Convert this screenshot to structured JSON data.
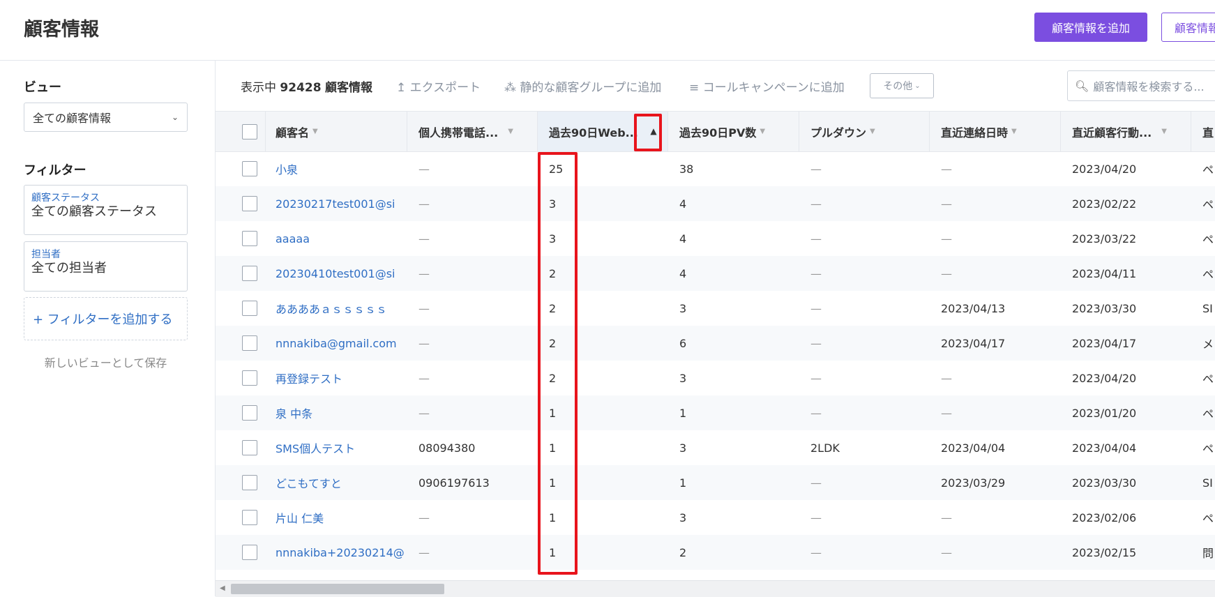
{
  "header": {
    "title": "顧客情報",
    "add_button": "顧客情報を追加",
    "secondary_button": "顧客情報"
  },
  "sidebar": {
    "view_heading": "ビュー",
    "view_selected": "全ての顧客情報",
    "filter_heading": "フィルター",
    "filters": [
      {
        "label": "顧客ステータス",
        "value": "全ての顧客ステータス"
      },
      {
        "label": "担当者",
        "value": "全ての担当者"
      }
    ],
    "add_filter": "+ フィルターを追加する",
    "save_view": "新しいビューとして保存"
  },
  "toolbar": {
    "count_prefix": "表示中",
    "count": "92428",
    "count_suffix": "顧客情報",
    "export": "エクスポート",
    "add_static_group": "静的な顧客グループに追加",
    "add_call_campaign": "コールキャンペーンに追加",
    "other": "その他",
    "search_placeholder": "顧客情報を検索する..."
  },
  "table": {
    "columns": [
      "顧客名",
      "個人携帯電話...",
      "過去90日Web...",
      "過去90日PV数",
      "プルダウン",
      "直近連絡日時",
      "直近顧客行動...",
      "直"
    ],
    "rows": [
      {
        "name": "小泉",
        "phone": "—",
        "web90": "25",
        "pv90": "38",
        "pulldown": "—",
        "last_contact": "—",
        "last_action": "2023/04/20",
        "extra": "ペ"
      },
      {
        "name": "20230217test001@si",
        "phone": "—",
        "web90": "3",
        "pv90": "4",
        "pulldown": "—",
        "last_contact": "—",
        "last_action": "2023/02/22",
        "extra": "ペ"
      },
      {
        "name": "aaaaa",
        "phone": "—",
        "web90": "3",
        "pv90": "4",
        "pulldown": "—",
        "last_contact": "—",
        "last_action": "2023/03/22",
        "extra": "ペ"
      },
      {
        "name": "20230410test001@si",
        "phone": "—",
        "web90": "2",
        "pv90": "4",
        "pulldown": "—",
        "last_contact": "—",
        "last_action": "2023/04/11",
        "extra": "ペ"
      },
      {
        "name": "ああああａｓｓｓｓｓ",
        "phone": "—",
        "web90": "2",
        "pv90": "3",
        "pulldown": "—",
        "last_contact": "2023/04/13",
        "last_action": "2023/03/30",
        "extra": "SI"
      },
      {
        "name": "nnnakiba@gmail.com",
        "phone": "—",
        "web90": "2",
        "pv90": "6",
        "pulldown": "—",
        "last_contact": "2023/04/17",
        "last_action": "2023/04/17",
        "extra": "メ"
      },
      {
        "name": "再登録テスト",
        "phone": "—",
        "web90": "2",
        "pv90": "3",
        "pulldown": "—",
        "last_contact": "—",
        "last_action": "2023/04/20",
        "extra": "ペ"
      },
      {
        "name": "泉 中条",
        "phone": "—",
        "web90": "1",
        "pv90": "1",
        "pulldown": "—",
        "last_contact": "—",
        "last_action": "2023/01/20",
        "extra": "ペ"
      },
      {
        "name": "SMS個人テスト",
        "phone": "08094380",
        "web90": "1",
        "pv90": "3",
        "pulldown": "2LDK",
        "last_contact": "2023/04/04",
        "last_action": "2023/04/04",
        "extra": "ペ"
      },
      {
        "name": "どこもてすと",
        "phone": "0906197613",
        "web90": "1",
        "pv90": "1",
        "pulldown": "—",
        "last_contact": "2023/03/29",
        "last_action": "2023/03/30",
        "extra": "SI"
      },
      {
        "name": "片山 仁美",
        "phone": "—",
        "web90": "1",
        "pv90": "3",
        "pulldown": "—",
        "last_contact": "—",
        "last_action": "2023/02/06",
        "extra": "ペ"
      },
      {
        "name": "nnnakiba+20230214@",
        "phone": "—",
        "web90": "1",
        "pv90": "2",
        "pulldown": "—",
        "last_contact": "—",
        "last_action": "2023/02/15",
        "extra": "問"
      }
    ]
  },
  "colors": {
    "accent": "#7b4ee0",
    "link": "#2f6ec4",
    "highlight": "#e8141c"
  }
}
